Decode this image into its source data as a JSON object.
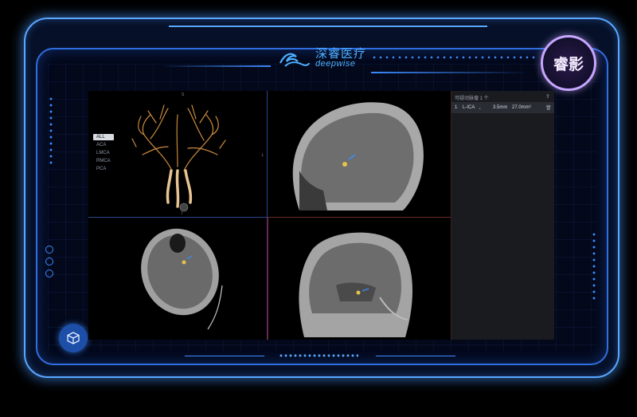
{
  "brand": {
    "name_cn": "深睿医疗",
    "name_en": "deepwise"
  },
  "badge": {
    "label": "睿影"
  },
  "viewport_3d": {
    "vessel_menu": [
      "ALL",
      "ACA",
      "LMCA",
      "RMCA",
      "PCA"
    ],
    "selected": "ALL",
    "marker_top": "S",
    "marker_bottom": "I",
    "marker_right": "L"
  },
  "right_panel": {
    "header": "可疑动脉瘤 1 个",
    "rows": [
      {
        "index": "1",
        "location": "L-ICA",
        "size": "3.5mm",
        "volume": "27.0mm³"
      }
    ]
  },
  "icons": {
    "cube": "cube-icon",
    "export": "export-icon",
    "delete": "trash-icon",
    "dropdown": "chevron-down-icon"
  },
  "colors": {
    "accent": "#3b8bff",
    "frame": "#5aa7ff",
    "badge_ring": "#c7a6ff",
    "cube_button": "#1d4fa8"
  }
}
